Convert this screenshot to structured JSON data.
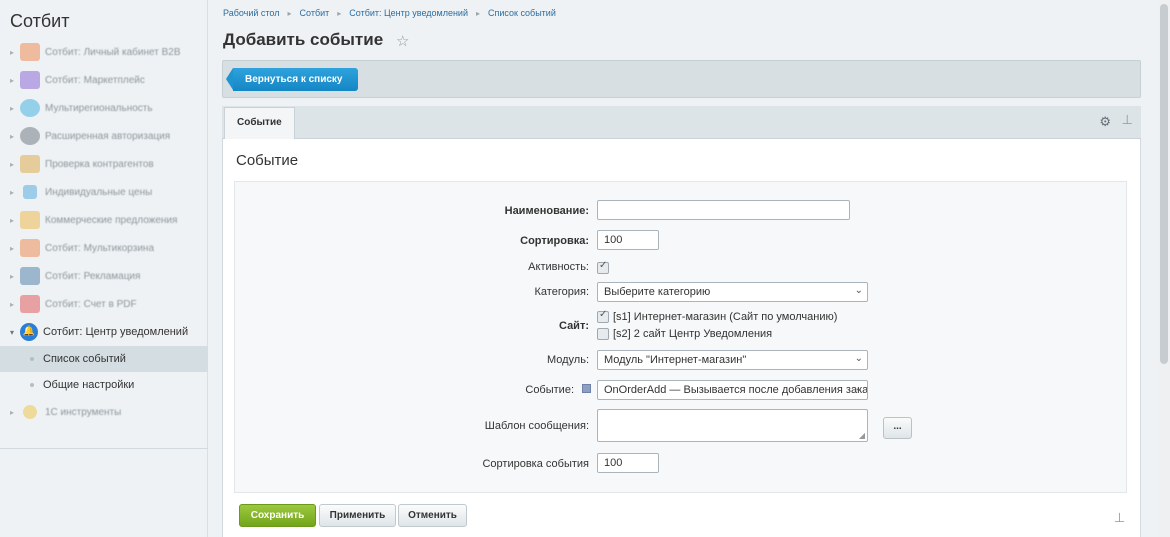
{
  "sidebar": {
    "title": "Сотбит",
    "items": [
      {
        "label": "Сотбит: Личный кабинет B2B",
        "icon": "b2b-icon",
        "color": "#f07a3a"
      },
      {
        "label": "Сотбит: Маркетплейс",
        "icon": "marketplace-icon",
        "color": "#7b4fd1"
      },
      {
        "label": "Мультирегиональность",
        "icon": "location-icon",
        "color": "#2ba8e0"
      },
      {
        "label": "Расширенная авторизация",
        "icon": "auth-icon",
        "color": "#5c6770"
      },
      {
        "label": "Проверка контрагентов",
        "icon": "search-person-icon",
        "color": "#e0a030"
      },
      {
        "label": "Индивидуальные цены",
        "icon": "price-icon",
        "color": "#3aa0d8"
      },
      {
        "label": "Коммерческие предложения",
        "icon": "offer-icon",
        "color": "#f0b030"
      },
      {
        "label": "Сотбит: Мультикорзина",
        "icon": "cart-icon",
        "color": "#f07a3a"
      },
      {
        "label": "Сотбит: Рекламация",
        "icon": "complaint-icon",
        "color": "#3a6ea0"
      },
      {
        "label": "Сотбит: Счет в PDF",
        "icon": "pdf-icon",
        "color": "#e04040"
      }
    ],
    "open_item": {
      "label": "Сотбит: Центр уведомлений",
      "icon": "bell-icon",
      "color": "#2b7ed8"
    },
    "sub_items": [
      "Список событий",
      "Общие настройки"
    ],
    "last_item": {
      "label": "1С инструменты",
      "icon": "onec-icon",
      "color": "#f0c030"
    }
  },
  "breadcrumb": [
    "Рабочий стол",
    "Сотбит",
    "Сотбит: Центр уведомлений",
    "Список событий"
  ],
  "page": {
    "title": "Добавить событие"
  },
  "toolbar": {
    "back_label": "Вернуться к списку"
  },
  "tabs": [
    {
      "label": "Событие"
    }
  ],
  "form": {
    "section_title": "Событие",
    "name_label": "Наименование:",
    "name_value": "",
    "sort_label": "Сортировка:",
    "sort_value": "100",
    "active_label": "Активность:",
    "active_checked": true,
    "category_label": "Категория:",
    "category_value": "Выберите категорию",
    "site_label": "Сайт:",
    "sites": [
      {
        "label": "[s1] Интернет-магазин (Сайт по умолчанию)",
        "checked": true
      },
      {
        "label": "[s2] 2 сайт Центр Уведомления",
        "checked": false
      }
    ],
    "module_label": "Модуль:",
    "module_value": "Модуль \"Интернет-магазин\"",
    "event_label": "Событие:",
    "event_value": "OnOrderAdd — Вызывается после добавления заказа",
    "template_label": "Шаблон сообщения:",
    "template_button": "...",
    "event_sort_label": "Сортировка события",
    "event_sort_value": "100"
  },
  "buttons": {
    "save": "Сохранить",
    "apply": "Применить",
    "cancel": "Отменить"
  }
}
